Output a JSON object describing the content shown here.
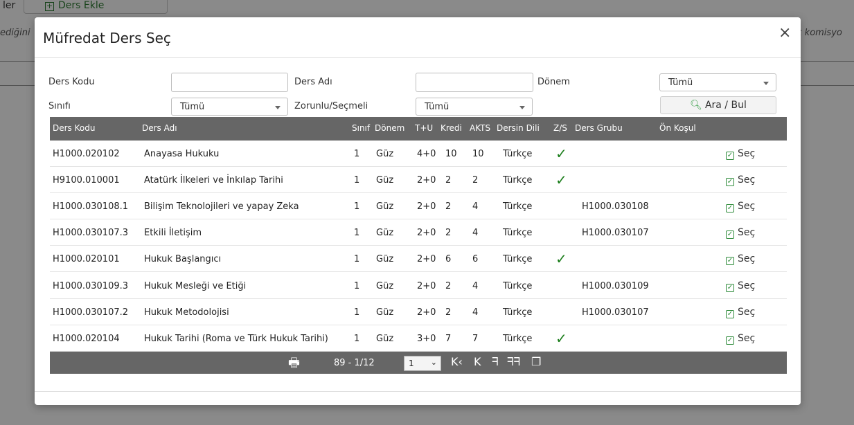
{
  "background": {
    "left_text": "ler",
    "add_button": "Ders Ekle",
    "left_italic": "ediğini",
    "right_italic": "k komisyo"
  },
  "modal": {
    "title": "Müfredat Ders Seç",
    "close": "×"
  },
  "filters": {
    "ders_kodu_label": "Ders Kodu",
    "ders_kodu_value": "",
    "ders_adi_label": "Ders Adı",
    "ders_adi_value": "",
    "donem_label": "Dönem",
    "donem_value": "Tümü",
    "sinifi_label": "Sınıfı",
    "sinifi_value": "Tümü",
    "zorunlu_label": "Zorunlu/Seçmeli",
    "zorunlu_value": "Tümü",
    "search_button": "Ara / Bul"
  },
  "table": {
    "headers": [
      "Ders Kodu",
      "Ders Adı",
      "Sınıf",
      "Dönem",
      "T+U",
      "Kredi",
      "AKTS",
      "Dersin Dili",
      "Z/S",
      "Ders Grubu",
      "Ön Koşul"
    ],
    "select_label": "Seç",
    "rows": [
      {
        "kod": "H1000.020102",
        "ad": "Anayasa Hukuku",
        "sinif": "1",
        "donem": "Güz",
        "tu": "4+0",
        "kredi": "10",
        "akts": "10",
        "dil": "Türkçe",
        "zs": true,
        "grup": ""
      },
      {
        "kod": "H9100.010001",
        "ad": "Atatürk İlkeleri ve İnkılap Tarihi",
        "sinif": "1",
        "donem": "Güz",
        "tu": "2+0",
        "kredi": "2",
        "akts": "2",
        "dil": "Türkçe",
        "zs": true,
        "grup": ""
      },
      {
        "kod": "H1000.030108.1",
        "ad": "Bilişim Teknolojileri ve yapay Zeka",
        "sinif": "1",
        "donem": "Güz",
        "tu": "2+0",
        "kredi": "2",
        "akts": "4",
        "dil": "Türkçe",
        "zs": false,
        "grup": "H1000.030108"
      },
      {
        "kod": "H1000.030107.3",
        "ad": "Etkili İletişim",
        "sinif": "1",
        "donem": "Güz",
        "tu": "2+0",
        "kredi": "2",
        "akts": "4",
        "dil": "Türkçe",
        "zs": false,
        "grup": "H1000.030107"
      },
      {
        "kod": "H1000.020101",
        "ad": "Hukuk Başlangıcı",
        "sinif": "1",
        "donem": "Güz",
        "tu": "2+0",
        "kredi": "6",
        "akts": "6",
        "dil": "Türkçe",
        "zs": true,
        "grup": ""
      },
      {
        "kod": "H1000.030109.3",
        "ad": "Hukuk Mesleği ve Etiği",
        "sinif": "1",
        "donem": "Güz",
        "tu": "2+0",
        "kredi": "2",
        "akts": "4",
        "dil": "Türkçe",
        "zs": false,
        "grup": "H1000.030109"
      },
      {
        "kod": "H1000.030107.2",
        "ad": "Hukuk Metodolojisi",
        "sinif": "1",
        "donem": "Güz",
        "tu": "2+0",
        "kredi": "2",
        "akts": "4",
        "dil": "Türkçe",
        "zs": false,
        "grup": "H1000.030107"
      },
      {
        "kod": "H1000.020104",
        "ad": "Hukuk Tarihi (Roma ve Türk Hukuk Tarihi)",
        "sinif": "1",
        "donem": "Güz",
        "tu": "3+0",
        "kredi": "7",
        "akts": "7",
        "dil": "Türkçe",
        "zs": true,
        "grup": ""
      }
    ]
  },
  "pager": {
    "info": "89 - 1/12",
    "page": "1",
    "icons": [
      "print-icon",
      "first-page-icon",
      "prev-page-icon",
      "next-page-icon",
      "last-page-icon",
      "copy-icon"
    ]
  },
  "colors": {
    "header_bg": "#666666",
    "check_green": "#1a7d1a",
    "select_green": "#2e8b3a"
  }
}
